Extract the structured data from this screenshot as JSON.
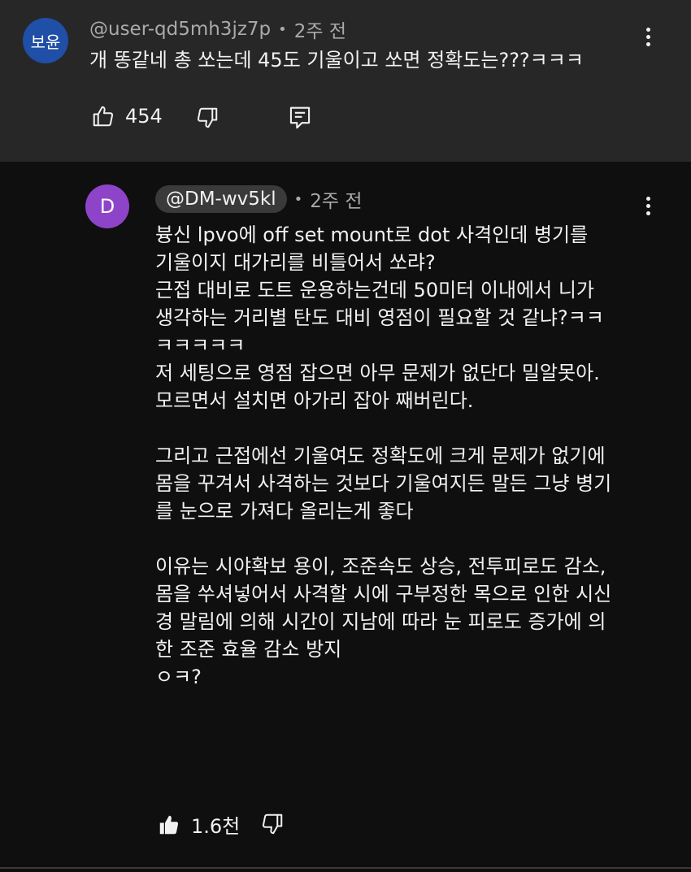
{
  "comment": {
    "avatar_text": "보윤",
    "handle": "@user-qd5mh3jz7p",
    "time": "2주 전",
    "text": "개 똥같네 총 쏘는데 45도 기울이고 쏘면 정확도는???ㅋㅋㅋ",
    "like_count": "454"
  },
  "reply": {
    "avatar_text": "D",
    "handle": "@DM-wv5kl",
    "time": "2주 전",
    "text": "븅신 lpvo에 off set mount로 dot 사격인데 병기를\n기울이지 대가리를 비틀어서 쏘랴?\n근접 대비로 도트 운용하는건데 50미터 이내에서 니가\n생각하는 거리별 탄도 대비 영점이 필요할 것 같냐?ㅋㅋ\nㅋㅋㅋㅋㅋ\n저 세팅으로 영점 잡으면 아무 문제가 없단다 밀알못아.\n모르면서 설치면 아가리 잡아 째버린다.\n\n그리고 근접에선 기울여도 정확도에 크게 문제가 없기에\n몸을 꾸겨서 사격하는 것보다 기울여지든 말든 그냥 병기\n를 눈으로 가져다 올리는게 좋다\n\n이유는 시야확보 용이, 조준속도 상승, 전투피로도 감소,\n몸을 쑤셔넣어서 사격할 시에 구부정한 목으로 인한 시신\n경 말림에 의해 시간이 지남에 따라 눈 피로도 증가에 의\n한 조준 효율 감소 방지\nㅇㅋ?",
    "like_count": "1.6천"
  },
  "colors": {
    "top_bg": "#272727",
    "page_bg": "#0f0f0f",
    "avatar1": "#1f4fa6",
    "avatar2": "#8e44c9",
    "meta_text": "#aaaaaa"
  },
  "icons": {
    "like": "thumb-up-outline-icon",
    "dislike": "thumb-down-outline-icon",
    "reply": "reply-comment-icon",
    "liked": "thumb-up-filled-icon",
    "more": "more-vertical-icon"
  }
}
